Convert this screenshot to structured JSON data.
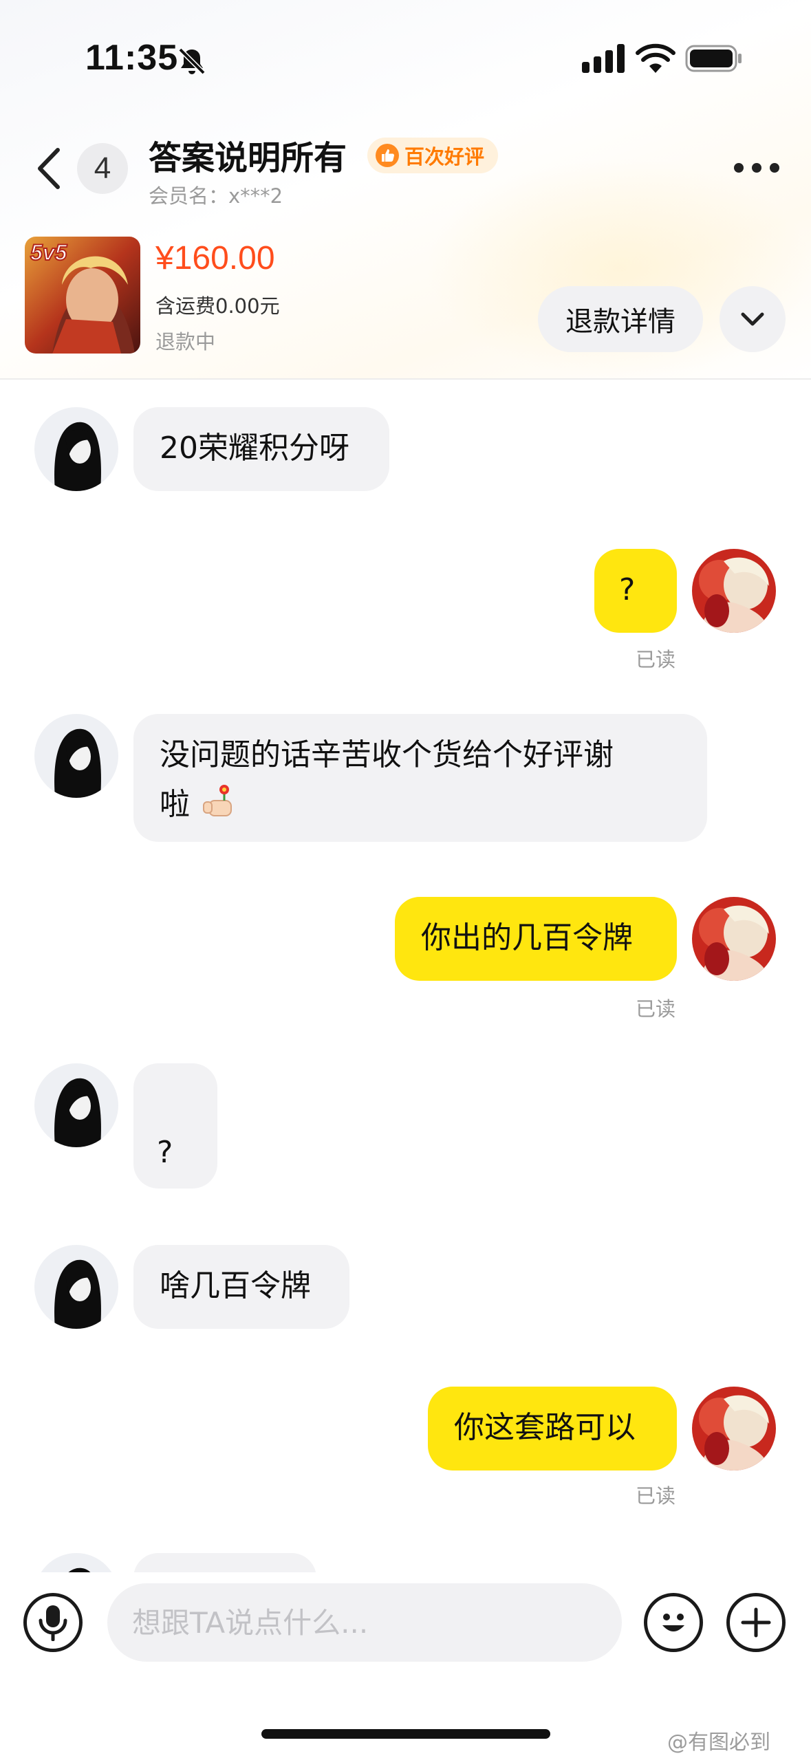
{
  "status_bar": {
    "time": "11:35",
    "icons": [
      "bell-slash-icon",
      "cellular-signal-icon",
      "wifi-icon",
      "battery-icon"
    ]
  },
  "header": {
    "unread_count": "4",
    "title": "答案说明所有",
    "rating_badge": "百次好评",
    "member_name": "会员名：x***2",
    "icons": [
      "back-chevron-icon",
      "more-dots-icon",
      "thumbs-up-icon"
    ]
  },
  "product": {
    "image_badge": "5v5",
    "price": "¥160.00",
    "shipping": "含运费0.00元",
    "status": "退款中",
    "refund_button": "退款详情"
  },
  "messages": [
    {
      "side": "incoming",
      "text": "20荣耀积分呀"
    },
    {
      "side": "outgoing",
      "text": "?",
      "status": "已读"
    },
    {
      "side": "incoming",
      "text": "没问题的话辛苦收个货给个好评谢",
      "text_line2": "啦",
      "emoji": "hand-holding-flower-icon"
    },
    {
      "side": "outgoing",
      "text": "你出的几百令牌",
      "status": "已读"
    },
    {
      "side": "incoming",
      "text": "?"
    },
    {
      "side": "incoming",
      "text": "啥几百令牌"
    },
    {
      "side": "outgoing",
      "text": "你这套路可以",
      "status": "已读"
    },
    {
      "side": "incoming",
      "text": ""
    }
  ],
  "input_bar": {
    "placeholder": "想跟TA说点什么...",
    "icons": [
      "microphone-icon",
      "emoji-face-icon",
      "plus-icon"
    ]
  },
  "watermark": "@有图必到",
  "colors": {
    "outgoing_bubble": "#ffe60f",
    "incoming_bubble": "#f2f2f4",
    "price": "#ff4d1c",
    "badge_accent": "#ff7a00"
  }
}
